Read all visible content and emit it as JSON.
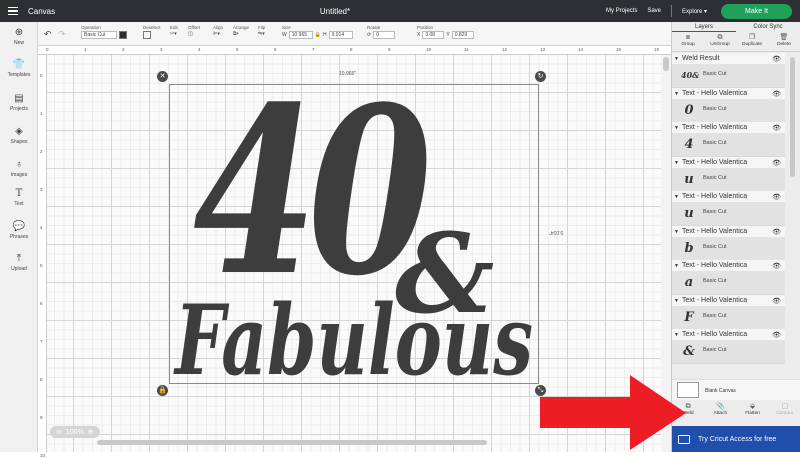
{
  "app": {
    "name": "Canvas",
    "document_title": "Untitled*"
  },
  "topbar": {
    "my_projects": "My Projects",
    "save": "Save",
    "explore": "Explore",
    "make_it": "Make It"
  },
  "toolbar": {
    "operation_label": "Operation",
    "operation_value": "Basic Cut",
    "deselect": "Deselect",
    "edit": "Edit",
    "offset": "Offset",
    "align": "Align",
    "arrange": "Arrange",
    "flip": "Flip",
    "size_label": "Size",
    "w_label": "W",
    "w_value": "10.965",
    "h_label": "H",
    "h_value": "9.014",
    "rotate_label": "Rotate",
    "rotate_value": "0",
    "position_label": "Position",
    "x_label": "X",
    "x_value": "3.08",
    "y_label": "Y",
    "y_value": "0.829"
  },
  "sidebar": {
    "items": [
      {
        "label": "New",
        "icon": "plus-icon"
      },
      {
        "label": "Templates",
        "icon": "shirt-icon"
      },
      {
        "label": "Projects",
        "icon": "projects-icon"
      },
      {
        "label": "Shapes",
        "icon": "shapes-icon"
      },
      {
        "label": "Images",
        "icon": "bulb-icon"
      },
      {
        "label": "Text",
        "icon": "text-icon"
      },
      {
        "label": "Phrases",
        "icon": "phrases-icon"
      },
      {
        "label": "Upload",
        "icon": "upload-icon"
      }
    ]
  },
  "ruler": {
    "top": [
      "0",
      "1",
      "2",
      "3",
      "4",
      "5",
      "6",
      "7",
      "8",
      "9",
      "10",
      "11",
      "12",
      "13",
      "14",
      "15",
      "16"
    ],
    "left": [
      "0",
      "1",
      "2",
      "3",
      "4",
      "5",
      "6",
      "7",
      "8",
      "9",
      "10"
    ]
  },
  "canvas": {
    "width_dim": "10.965\"",
    "height_dim": "9.014\"",
    "artwork_line1": "40",
    "artwork_amp": "&",
    "artwork_line2": "Fabulous",
    "zoom": "100%"
  },
  "panel": {
    "tabs": [
      "Layers",
      "Color Sync"
    ],
    "tools": [
      "Group",
      "UnGroup",
      "Duplicate",
      "Delete"
    ],
    "layers": [
      {
        "title": "Weld Result",
        "type": "Basic Cut",
        "thumb": "40&"
      },
      {
        "title": "Text - Hello Valentica",
        "type": "Basic Cut",
        "thumb": "0"
      },
      {
        "title": "Text - Hello Valentica",
        "type": "Basic Cut",
        "thumb": "4"
      },
      {
        "title": "Text - Hello Valentica",
        "type": "Basic Cut",
        "thumb": "u"
      },
      {
        "title": "Text - Hello Valentica",
        "type": "Basic Cut",
        "thumb": "u"
      },
      {
        "title": "Text - Hello Valentica",
        "type": "Basic Cut",
        "thumb": "b"
      },
      {
        "title": "Text - Hello Valentica",
        "type": "Basic Cut",
        "thumb": "a"
      },
      {
        "title": "Text - Hello Valentica",
        "type": "Basic Cut",
        "thumb": "F"
      },
      {
        "title": "Text - Hello Valentica",
        "type": "Basic Cut",
        "thumb": "&"
      }
    ],
    "blank_canvas": "Blank Canvas",
    "actions": [
      "Weld",
      "Attach",
      "Flatten",
      "Contour"
    ],
    "promo": "Try Cricut Access for free"
  },
  "colors": {
    "accent_green": "#21a05a",
    "promo_blue": "#1f4faa",
    "arrow_red": "#ee1c25",
    "artwork": "#3d3d3d"
  }
}
